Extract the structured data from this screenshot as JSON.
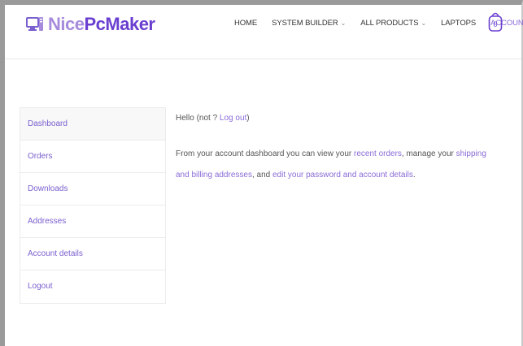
{
  "brand": {
    "part1": "Nice",
    "part2": "PcMaker"
  },
  "nav": {
    "items": [
      {
        "label": "HOME",
        "dropdown": false,
        "accent": false
      },
      {
        "label": "SYSTEM BUILDER",
        "dropdown": true,
        "accent": false
      },
      {
        "label": "ALL PRODUCTS",
        "dropdown": true,
        "accent": false
      },
      {
        "label": "LAPTOPS",
        "dropdown": false,
        "accent": false
      },
      {
        "label": "ACCOUNT",
        "dropdown": true,
        "accent": true
      }
    ],
    "caret": "⌄",
    "cart_count": "0"
  },
  "sidebar": {
    "items": [
      {
        "label": "Dashboard",
        "active": true
      },
      {
        "label": "Orders",
        "active": false
      },
      {
        "label": "Downloads",
        "active": false
      },
      {
        "label": "Addresses",
        "active": false
      },
      {
        "label": "Account details",
        "active": false
      },
      {
        "label": "Logout",
        "active": false
      }
    ]
  },
  "content": {
    "hello_prefix": "Hello (not ? ",
    "logout_link": "Log out",
    "hello_suffix": ")",
    "para_1": "From your account dashboard you can view your ",
    "recent_orders_link": "recent orders",
    "para_2": ", manage your ",
    "addresses_link": "shipping and billing addresses",
    "para_3": ", and ",
    "account_link": "edit your password and account details",
    "para_4": "."
  },
  "colors": {
    "accent": "#8a6bd6",
    "brand_light": "#a78bdc",
    "brand_dark": "#6b3fd0"
  },
  "icons": {
    "logo": "computer-icon",
    "cart": "shopping-bag-icon"
  }
}
